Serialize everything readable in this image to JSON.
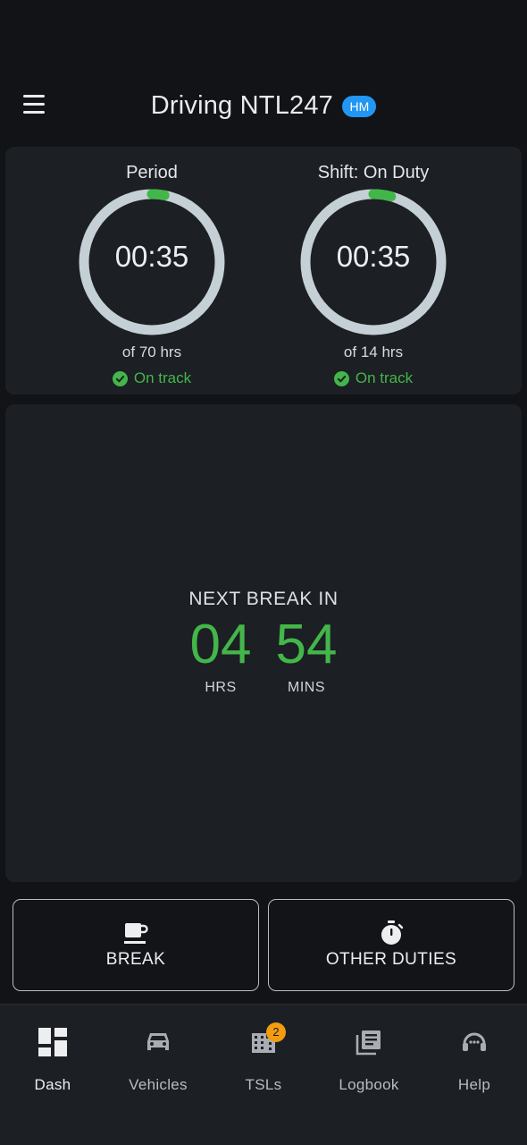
{
  "header": {
    "title": "Driving NTL247",
    "badge": "HM"
  },
  "timers": [
    {
      "title": "Period",
      "value": "00:35",
      "sub": "of 70 hrs",
      "status": "On track",
      "progress": 0.008
    },
    {
      "title": "Shift: On Duty",
      "value": "00:35",
      "sub": "of 14 hrs",
      "status": "On track",
      "progress": 0.042
    }
  ],
  "next_break": {
    "label": "NEXT BREAK IN",
    "hours": "04",
    "hours_unit": "HRS",
    "minutes": "54",
    "minutes_unit": "MINS"
  },
  "actions": {
    "break_label": "BREAK",
    "other_duties_label": "OTHER DUTIES"
  },
  "nav": {
    "items": [
      {
        "label": "Dash",
        "icon": "dashboard-icon",
        "active": true
      },
      {
        "label": "Vehicles",
        "icon": "car-icon"
      },
      {
        "label": "TSLs",
        "icon": "building-icon",
        "badge": "2"
      },
      {
        "label": "Logbook",
        "icon": "logbook-icon"
      },
      {
        "label": "Help",
        "icon": "headset-icon"
      }
    ]
  },
  "colors": {
    "accent_green": "#43b649",
    "badge_blue": "#2196f3",
    "badge_orange": "#f39c12",
    "ring_track": "#c5d0d6"
  }
}
